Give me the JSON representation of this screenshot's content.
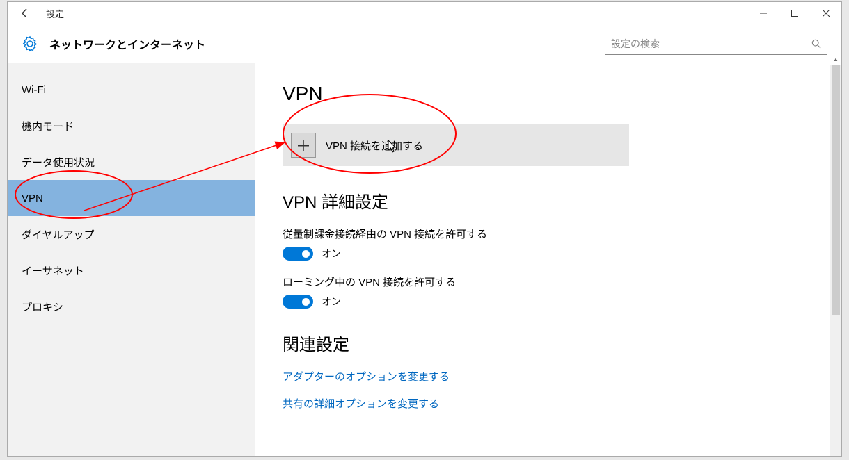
{
  "titlebar": {
    "title": "設定"
  },
  "header": {
    "title": "ネットワークとインターネット",
    "search_placeholder": "設定の検索"
  },
  "sidebar": {
    "items": [
      {
        "label": "Wi-Fi",
        "selected": false
      },
      {
        "label": "機内モード",
        "selected": false
      },
      {
        "label": "データ使用状況",
        "selected": false
      },
      {
        "label": "VPN",
        "selected": true
      },
      {
        "label": "ダイヤルアップ",
        "selected": false
      },
      {
        "label": "イーサネット",
        "selected": false
      },
      {
        "label": "プロキシ",
        "selected": false
      }
    ]
  },
  "content": {
    "section_vpn_title": "VPN",
    "add_vpn_label": "VPN 接続を追加する",
    "section_advanced_title": "VPN 詳細設定",
    "metered_label": "従量制課金接続経由の VPN 接続を許可する",
    "metered_state": "オン",
    "roaming_label": "ローミング中の VPN 接続を許可する",
    "roaming_state": "オン",
    "section_related_title": "関連設定",
    "link_adapter": "アダプターのオプションを変更する",
    "link_sharing": "共有の詳細オプションを変更する"
  },
  "colors": {
    "accent": "#0078d7",
    "sidebar_selected": "#84b3df",
    "link": "#0067c0",
    "annotation": "#ff0000"
  }
}
